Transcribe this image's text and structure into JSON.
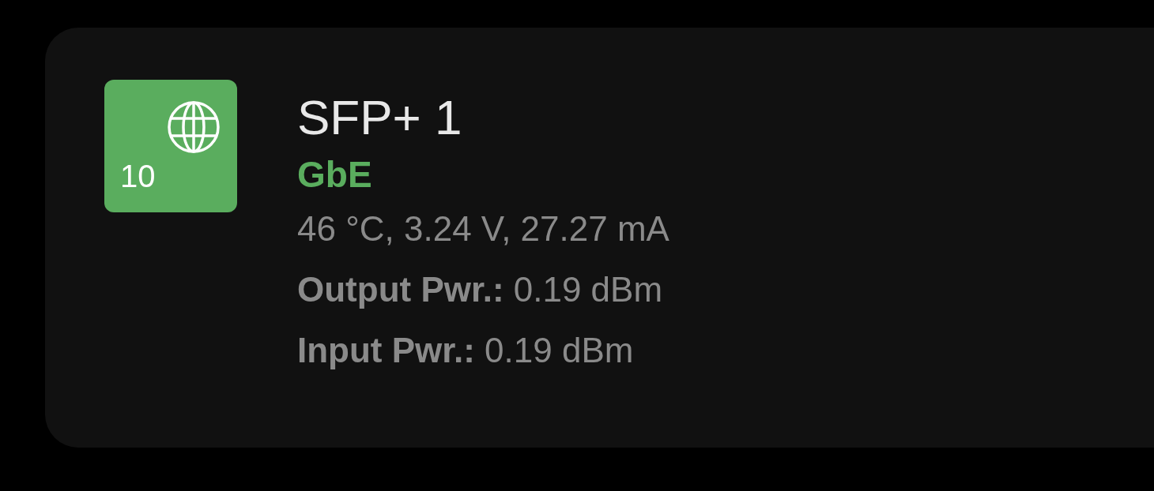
{
  "port": {
    "badge": "10",
    "link_up": true,
    "name": "SFP+ 1",
    "speed": "GbE",
    "details": [
      "46 °C, 3.24 V, 27.27 mA",
      "**Output Pwr.:** 0.19 dBm",
      "**Input Pwr.:** 0.19 dBm"
    ]
  }
}
